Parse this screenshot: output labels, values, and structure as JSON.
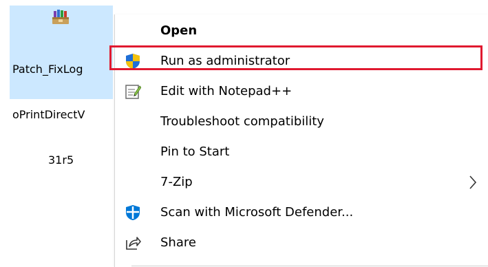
{
  "file": {
    "name_line1": "Patch_FixLog",
    "name_line2": "oPrintDirectV",
    "name_line3": "31r5",
    "icon": "archive-installer-icon"
  },
  "context_menu": {
    "items": [
      {
        "label": "Open",
        "bold": true,
        "icon": null
      },
      {
        "label": "Run as administrator",
        "icon": "uac-shield-icon",
        "highlighted": true
      },
      {
        "label": "Edit with Notepad++",
        "icon": "notepad-plus-plus-icon"
      },
      {
        "label": "Troubleshoot compatibility",
        "icon": null
      },
      {
        "label": "Pin to Start",
        "icon": null
      },
      {
        "label": "7-Zip",
        "icon": null,
        "submenu": true
      },
      {
        "label": "Scan with Microsoft Defender...",
        "icon": "defender-icon"
      },
      {
        "label": "Share",
        "icon": "share-icon"
      }
    ],
    "highlight_color": "#e0192f"
  },
  "colors": {
    "selection_bg": "#cce8ff",
    "accent_blue": "#0078d7"
  }
}
